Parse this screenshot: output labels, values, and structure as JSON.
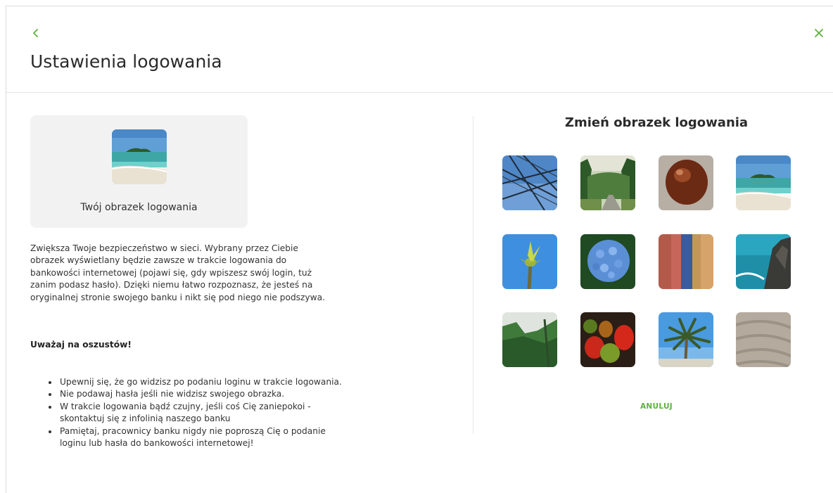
{
  "header": {
    "title": "Ustawienia logowania",
    "accent_color": "#5cb33a"
  },
  "current_image": {
    "label": "Twój obrazek logowania",
    "image": "beach"
  },
  "description": "Zwiększa Twoje bezpieczeństwo w sieci. Wybrany przez Ciebie obrazek wyświetlany będzie zawsze w trakcie logowania do bankowości internetowej (pojawi się, gdy wpiszesz swój login, tuż zanim podasz hasło). Dzięki niemu łatwo rozpoznasz, że jesteś na oryginalnej stronie swojego banku i nikt się pod niego nie podszywa.",
  "warning": {
    "title": "Uważaj na oszustów!",
    "tips": [
      "Upewnij się, że go widzisz po podaniu loginu w trakcie logowania.",
      "Nie podawaj hasła jeśli nie widzisz swojego obrazka.",
      "W trakcie logowania bądź czujny, jeśli coś Cię zaniepokoi - skontaktuj się z infolinią naszego banku",
      "Pamiętaj, pracownicy banku nigdy nie poproszą Cię o podanie loginu lub hasła do bankowości internetowej!"
    ]
  },
  "gallery": {
    "title": "Zmień obrazek logowania",
    "images": [
      "power-lines",
      "forest-road",
      "chestnut",
      "beach",
      "fig-sprout",
      "hydrangea",
      "painted-wall",
      "rocky-coast",
      "misty-forest",
      "vegetables",
      "palm-tree",
      "sand"
    ]
  },
  "actions": {
    "cancel": "ANULUJ"
  }
}
